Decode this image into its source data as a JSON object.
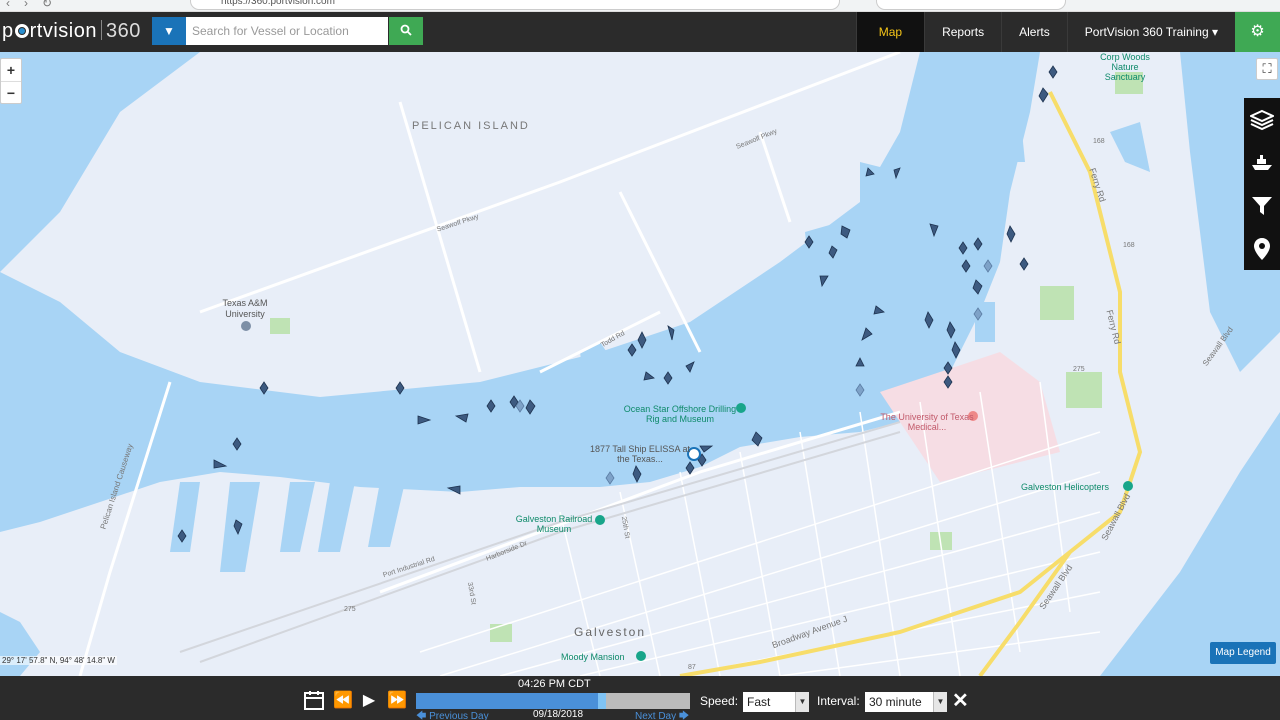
{
  "browser": {
    "url": "https://360.portvision.com"
  },
  "header": {
    "logo_text_a": "p",
    "logo_text_b": "rtvision",
    "logo_text_num": "360",
    "search_placeholder": "Search for Vessel or Location",
    "nav": [
      {
        "label": "Map",
        "active": true
      },
      {
        "label": "Reports"
      },
      {
        "label": "Alerts"
      },
      {
        "label": "PortVision 360 Training ▾"
      }
    ]
  },
  "map": {
    "zoom_in": "+",
    "zoom_out": "−",
    "legend_button": "Map Legend",
    "coordinates": "29° 17' 57.8\" N, 94° 48' 14.8\" W",
    "labels": {
      "pelican_island": "PELICAN ISLAND",
      "seawolf_1": "Seawolf Pkwy",
      "seawolf_2": "Seawolf Pkwy",
      "tamu": "Texas A&M University",
      "ocean_star": "Ocean Star Offshore Drilling Rig and Museum",
      "tall_ship": "1877 Tall Ship ELISSA at the Texas...",
      "utmb": "The University of Texas Medical...",
      "railroad": "Galveston Railroad Museum",
      "helicopters": "Galveston Helicopters",
      "galveston": "Galveston",
      "moody": "Moody Mansion",
      "corps": "Corp Woods Nature Sanctuary",
      "ferry_rd_1": "Ferry Rd",
      "ferry_rd_2": "Ferry Rd",
      "seawall_1": "Seawall Blvd",
      "seawall_2": "Seawall Blvd",
      "broadway": "Broadway Avenue J",
      "harborside": "Harborside Dr",
      "port_industrial": "Port Industrial Rd",
      "causeway": "Pelican Island Causeway",
      "todd_rd": "Todd Rd",
      "st25": "25th St",
      "st33": "33rd St",
      "r275a": "275",
      "r275b": "275",
      "r168a": "168",
      "r168b": "168",
      "r87": "87"
    }
  },
  "playback": {
    "time": "04:26 PM CDT",
    "progress": 0.68,
    "prev_day": "🡄 Previous Day",
    "date": "09/18/2018",
    "next_day": "Next Day 🡆",
    "speed_label": "Speed:",
    "speed_value": "Fast",
    "interval_label": "Interval:",
    "interval_value": "30 minute"
  },
  "colors": {
    "water": "#a8d4f5",
    "land": "#e8eef8",
    "accent_blue": "#1a73b8",
    "accent_green": "#3fa954",
    "active_nav": "#f5c518",
    "vessel": "#3d5a80"
  }
}
